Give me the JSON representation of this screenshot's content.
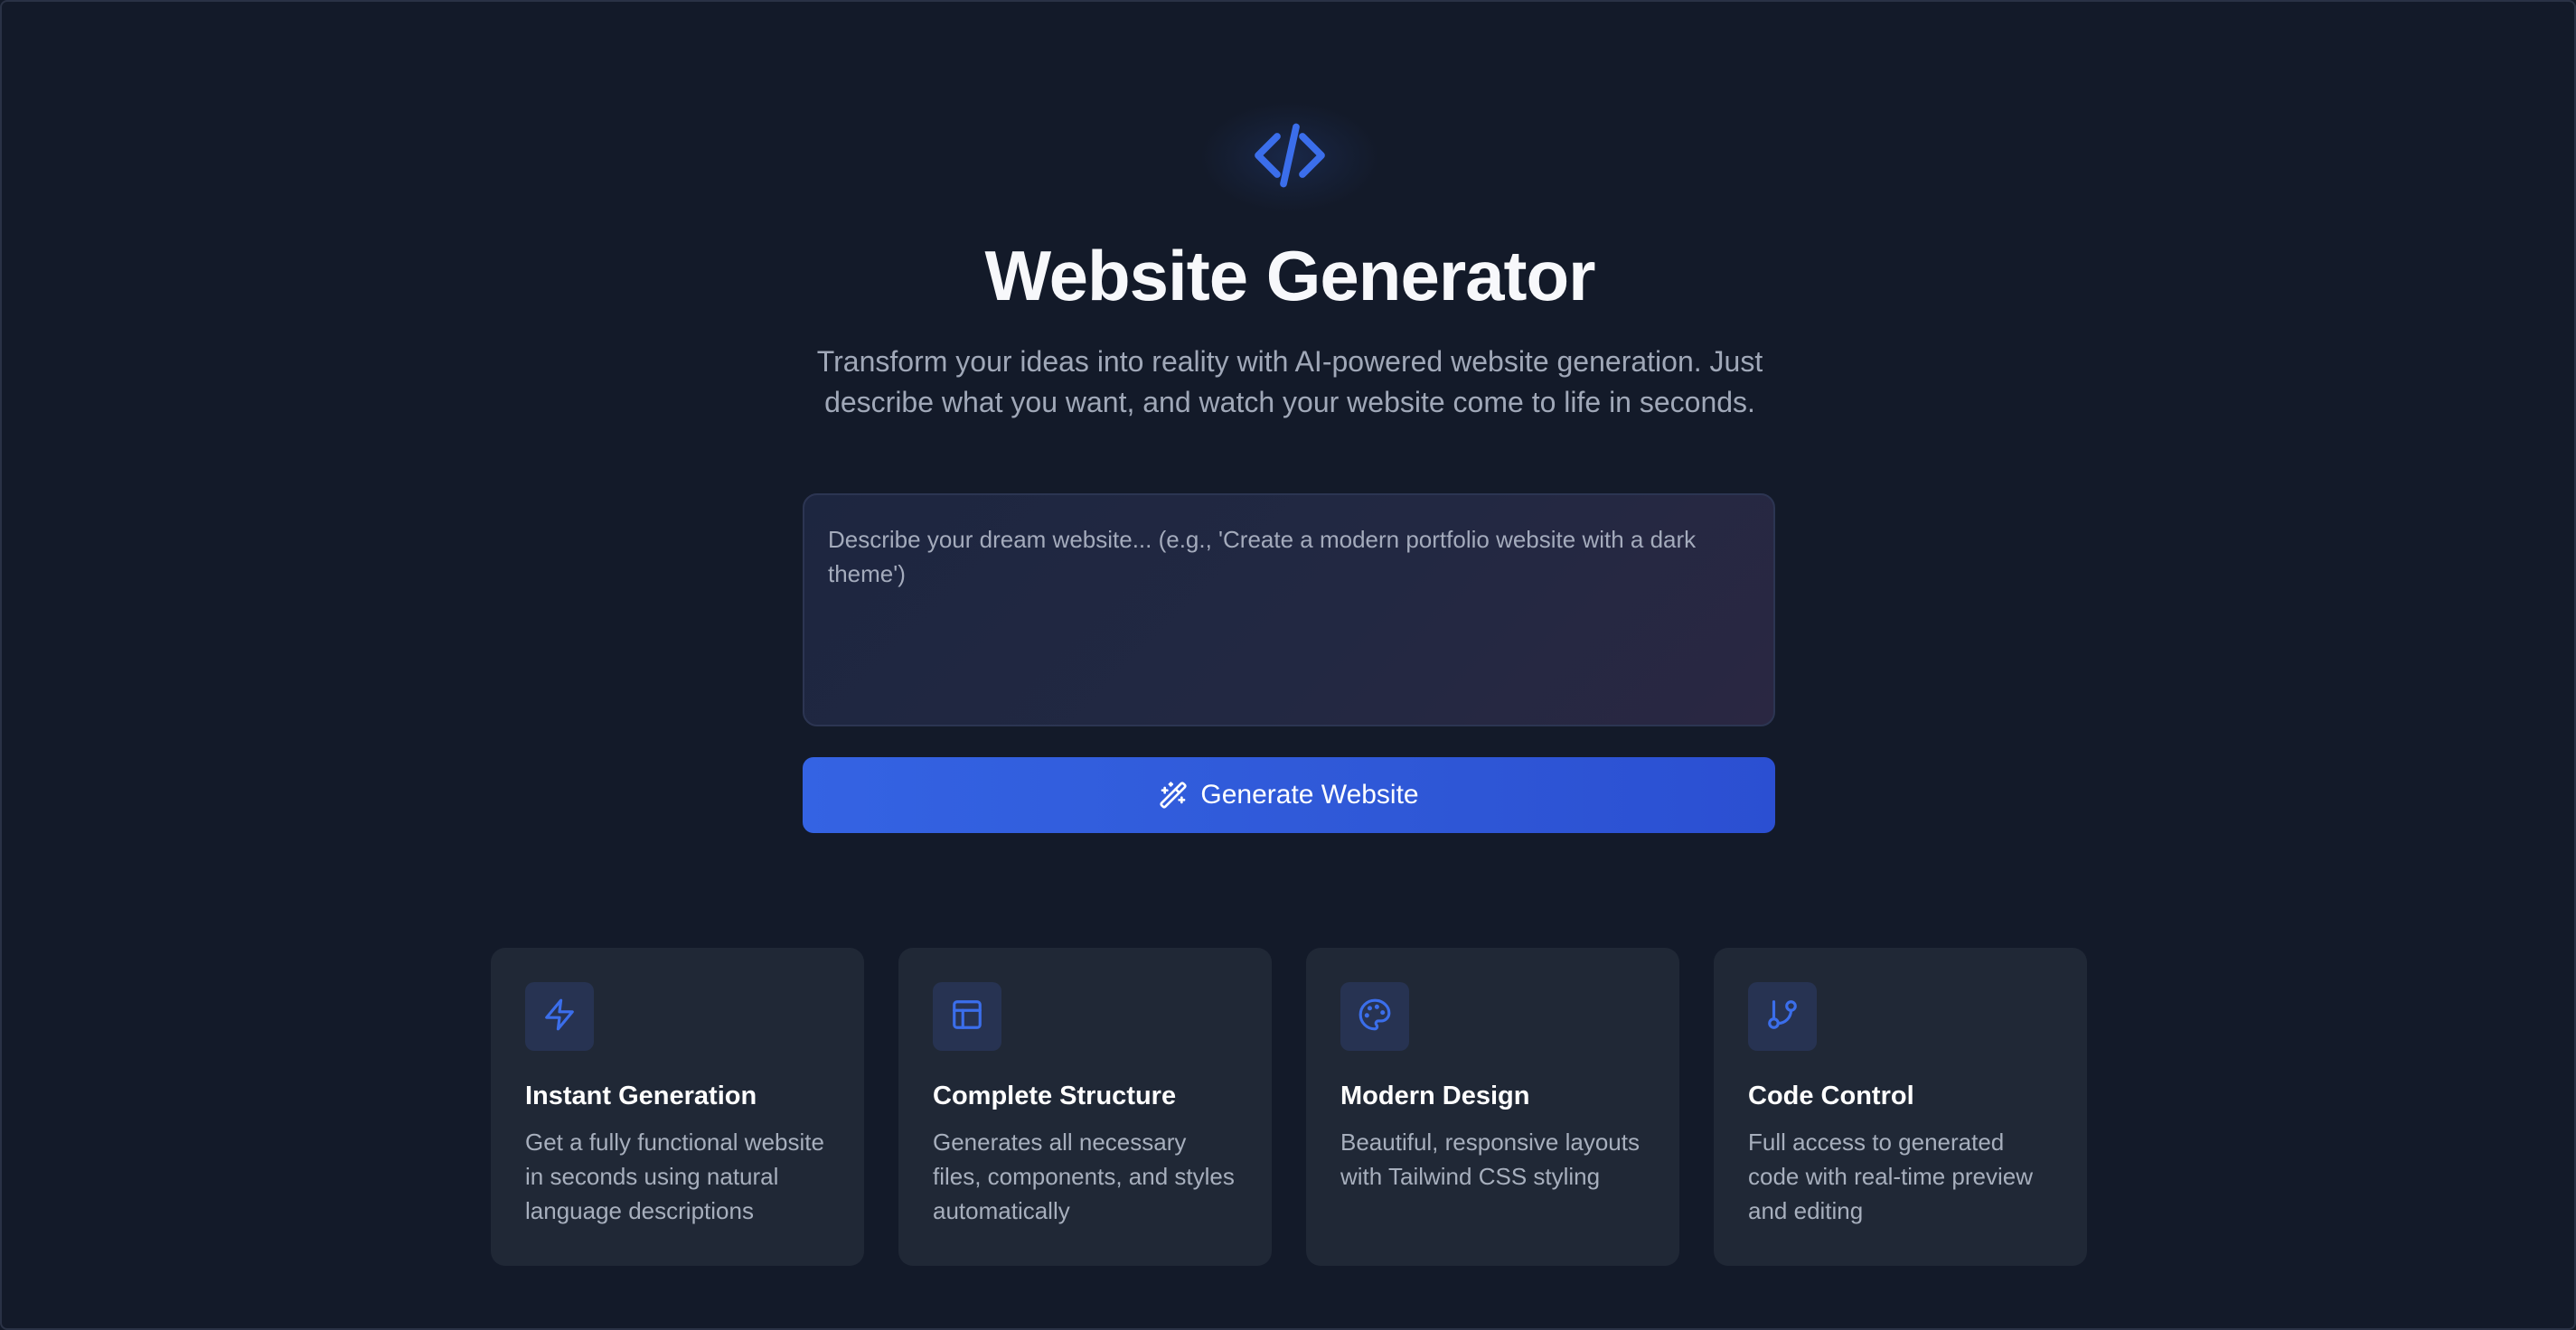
{
  "app": {
    "title": "Website Generator",
    "subtitle": "Transform your ideas into reality with AI-powered website generation. Just describe what you want, and watch your website come to life in seconds.",
    "logo_icon": "code-icon"
  },
  "prompt": {
    "placeholder": "Describe your dream website... (e.g., 'Create a modern portfolio website with a dark theme')",
    "value": ""
  },
  "generate_button": {
    "label": "Generate Website",
    "icon": "magic-wand-icon"
  },
  "features": [
    {
      "icon": "zap-icon",
      "title": "Instant Generation",
      "description": "Get a fully functional website in seconds using natural language descriptions"
    },
    {
      "icon": "layout-icon",
      "title": "Complete Structure",
      "description": "Generates all necessary files, components, and styles automatically"
    },
    {
      "icon": "palette-icon",
      "title": "Modern Design",
      "description": "Beautiful, responsive layouts with Tailwind CSS styling"
    },
    {
      "icon": "git-branch-icon",
      "title": "Code Control",
      "description": "Full access to generated code with real-time preview and editing"
    }
  ],
  "colors": {
    "background": "#131a29",
    "accent": "#3b6eeb",
    "card": "#202836",
    "text_primary": "#ffffff",
    "text_secondary": "#a0a8b8"
  }
}
